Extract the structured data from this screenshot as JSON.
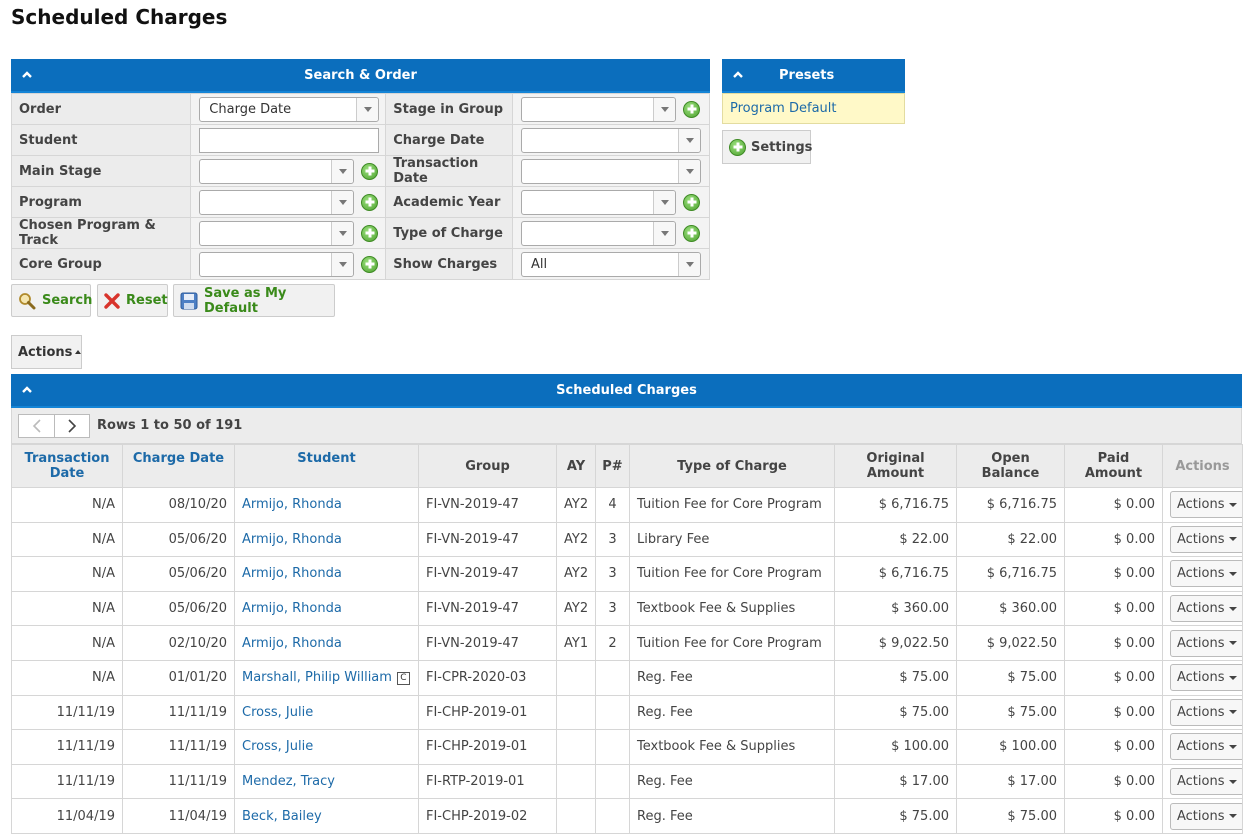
{
  "page": {
    "title": "Scheduled Charges"
  },
  "search_panel": {
    "title": "Search & Order",
    "rows": [
      {
        "left_label": "Order",
        "left_value": "Charge Date",
        "right_label": "Stage in Group",
        "right_value": ""
      },
      {
        "left_label": "Student",
        "left_value": "",
        "right_label": "Charge Date",
        "right_value": ""
      },
      {
        "left_label": "Main Stage",
        "left_value": "",
        "right_label": "Transaction Date",
        "right_value": ""
      },
      {
        "left_label": "Program",
        "left_value": "",
        "right_label": "Academic Year",
        "right_value": ""
      },
      {
        "left_label": "Chosen Program & Track",
        "left_value": "",
        "right_label": "Type of Charge",
        "right_value": ""
      },
      {
        "left_label": "Core Group",
        "left_value": "",
        "right_label": "Show Charges",
        "right_value": "All"
      }
    ],
    "buttons": {
      "search": "Search",
      "reset": "Reset",
      "save_default": "Save as My Default"
    }
  },
  "presets": {
    "title": "Presets",
    "items": [
      "Program Default"
    ],
    "settings_label": "Settings"
  },
  "actions_menu": {
    "label": "Actions"
  },
  "results": {
    "title": "Scheduled Charges",
    "rows_info": "Rows 1 to 50 of 191",
    "columns": {
      "transaction_date": "Transaction Date",
      "charge_date": "Charge Date",
      "student": "Student",
      "group": "Group",
      "ay": "AY",
      "p": "P#",
      "type": "Type of Charge",
      "original": "Original Amount",
      "open": "Open Balance",
      "paid": "Paid Amount",
      "actions": "Actions"
    },
    "row_action_label": "Actions",
    "rows": [
      {
        "transaction_date": "N/A",
        "charge_date": "08/10/20",
        "student": "Armijo, Rhonda",
        "badge": "",
        "group": "FI-VN-2019-47",
        "ay": "AY2",
        "p": "4",
        "type": "Tuition Fee for Core Program",
        "original": "$ 6,716.75",
        "open": "$ 6,716.75",
        "paid": "$ 0.00"
      },
      {
        "transaction_date": "N/A",
        "charge_date": "05/06/20",
        "student": "Armijo, Rhonda",
        "badge": "",
        "group": "FI-VN-2019-47",
        "ay": "AY2",
        "p": "3",
        "type": "Library Fee",
        "original": "$ 22.00",
        "open": "$ 22.00",
        "paid": "$ 0.00"
      },
      {
        "transaction_date": "N/A",
        "charge_date": "05/06/20",
        "student": "Armijo, Rhonda",
        "badge": "",
        "group": "FI-VN-2019-47",
        "ay": "AY2",
        "p": "3",
        "type": "Tuition Fee for Core Program",
        "original": "$ 6,716.75",
        "open": "$ 6,716.75",
        "paid": "$ 0.00"
      },
      {
        "transaction_date": "N/A",
        "charge_date": "05/06/20",
        "student": "Armijo, Rhonda",
        "badge": "",
        "group": "FI-VN-2019-47",
        "ay": "AY2",
        "p": "3",
        "type": "Textbook Fee & Supplies",
        "original": "$ 360.00",
        "open": "$ 360.00",
        "paid": "$ 0.00"
      },
      {
        "transaction_date": "N/A",
        "charge_date": "02/10/20",
        "student": "Armijo, Rhonda",
        "badge": "",
        "group": "FI-VN-2019-47",
        "ay": "AY1",
        "p": "2",
        "type": "Tuition Fee for Core Program",
        "original": "$ 9,022.50",
        "open": "$ 9,022.50",
        "paid": "$ 0.00"
      },
      {
        "transaction_date": "N/A",
        "charge_date": "01/01/20",
        "student": "Marshall, Philip William",
        "badge": "C",
        "group": "FI-CPR-2020-03",
        "ay": "",
        "p": "",
        "type": "Reg. Fee",
        "original": "$ 75.00",
        "open": "$ 75.00",
        "paid": "$ 0.00"
      },
      {
        "transaction_date": "11/11/19",
        "charge_date": "11/11/19",
        "student": "Cross, Julie",
        "badge": "",
        "group": "FI-CHP-2019-01",
        "ay": "",
        "p": "",
        "type": "Reg. Fee",
        "original": "$ 75.00",
        "open": "$ 75.00",
        "paid": "$ 0.00"
      },
      {
        "transaction_date": "11/11/19",
        "charge_date": "11/11/19",
        "student": "Cross, Julie",
        "badge": "",
        "group": "FI-CHP-2019-01",
        "ay": "",
        "p": "",
        "type": "Textbook Fee & Supplies",
        "original": "$ 100.00",
        "open": "$ 100.00",
        "paid": "$ 0.00"
      },
      {
        "transaction_date": "11/11/19",
        "charge_date": "11/11/19",
        "student": "Mendez, Tracy",
        "badge": "",
        "group": "FI-RTP-2019-01",
        "ay": "",
        "p": "",
        "type": "Reg. Fee",
        "original": "$ 17.00",
        "open": "$ 17.00",
        "paid": "$ 0.00"
      },
      {
        "transaction_date": "11/04/19",
        "charge_date": "11/04/19",
        "student": "Beck, Bailey",
        "badge": "",
        "group": "FI-CHP-2019-02",
        "ay": "",
        "p": "",
        "type": "Reg. Fee",
        "original": "$ 75.00",
        "open": "$ 75.00",
        "paid": "$ 0.00"
      }
    ]
  }
}
